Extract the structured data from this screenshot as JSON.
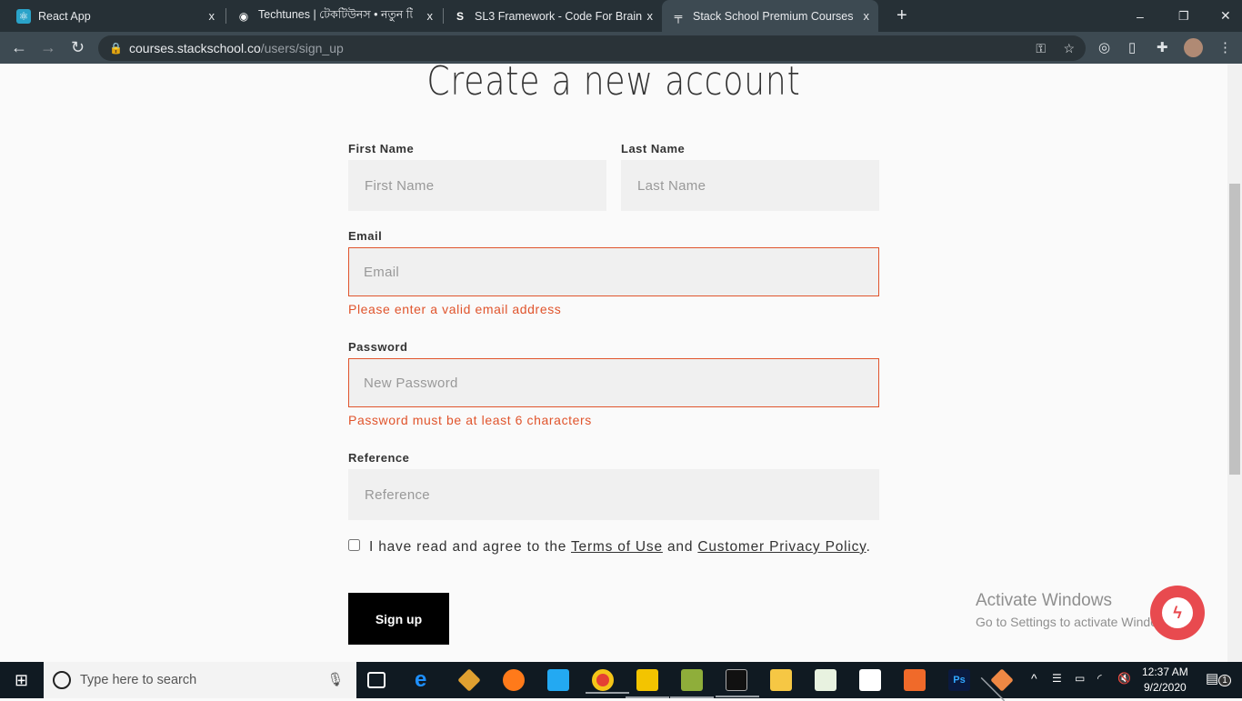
{
  "browser": {
    "tabs": [
      {
        "title": "React App",
        "icon": "react-icon"
      },
      {
        "title": "Techtunes | টেকটিউনস • নতুন টি",
        "icon": "globe-icon"
      },
      {
        "title": "SL3 Framework - Code For Brain",
        "icon": "sl3-icon"
      },
      {
        "title": "Stack School Premium Courses",
        "icon": "stackschool-icon",
        "active": true
      }
    ],
    "close": "x",
    "new_tab": "+",
    "url_host": "courses.stackschool.co",
    "url_path": "/users/sign_up"
  },
  "form": {
    "title": "Create a new account",
    "first_name_label": "First Name",
    "first_name_placeholder": "First Name",
    "last_name_label": "Last Name",
    "last_name_placeholder": "Last Name",
    "email_label": "Email",
    "email_placeholder": "Email",
    "email_error": "Please enter a valid email address",
    "password_label": "Password",
    "password_placeholder": "New Password",
    "password_error": "Password must be at least 6 characters",
    "reference_label": "Reference",
    "reference_placeholder": "Reference",
    "agree_prefix": "I have read and agree to the",
    "terms": "Terms of Use",
    "and": "and",
    "privacy": "Customer Privacy Policy",
    "period": ".",
    "submit": "Sign up"
  },
  "watermark": {
    "line1": "Activate Windows",
    "line2": "Go to Settings to activate Windows."
  },
  "taskbar": {
    "search_placeholder": "Type here to search",
    "time": "12:37 AM",
    "date": "9/2/2020",
    "notifications": "1"
  },
  "colors": {
    "error": "#e0542c",
    "messenger": "#e84a4f"
  }
}
